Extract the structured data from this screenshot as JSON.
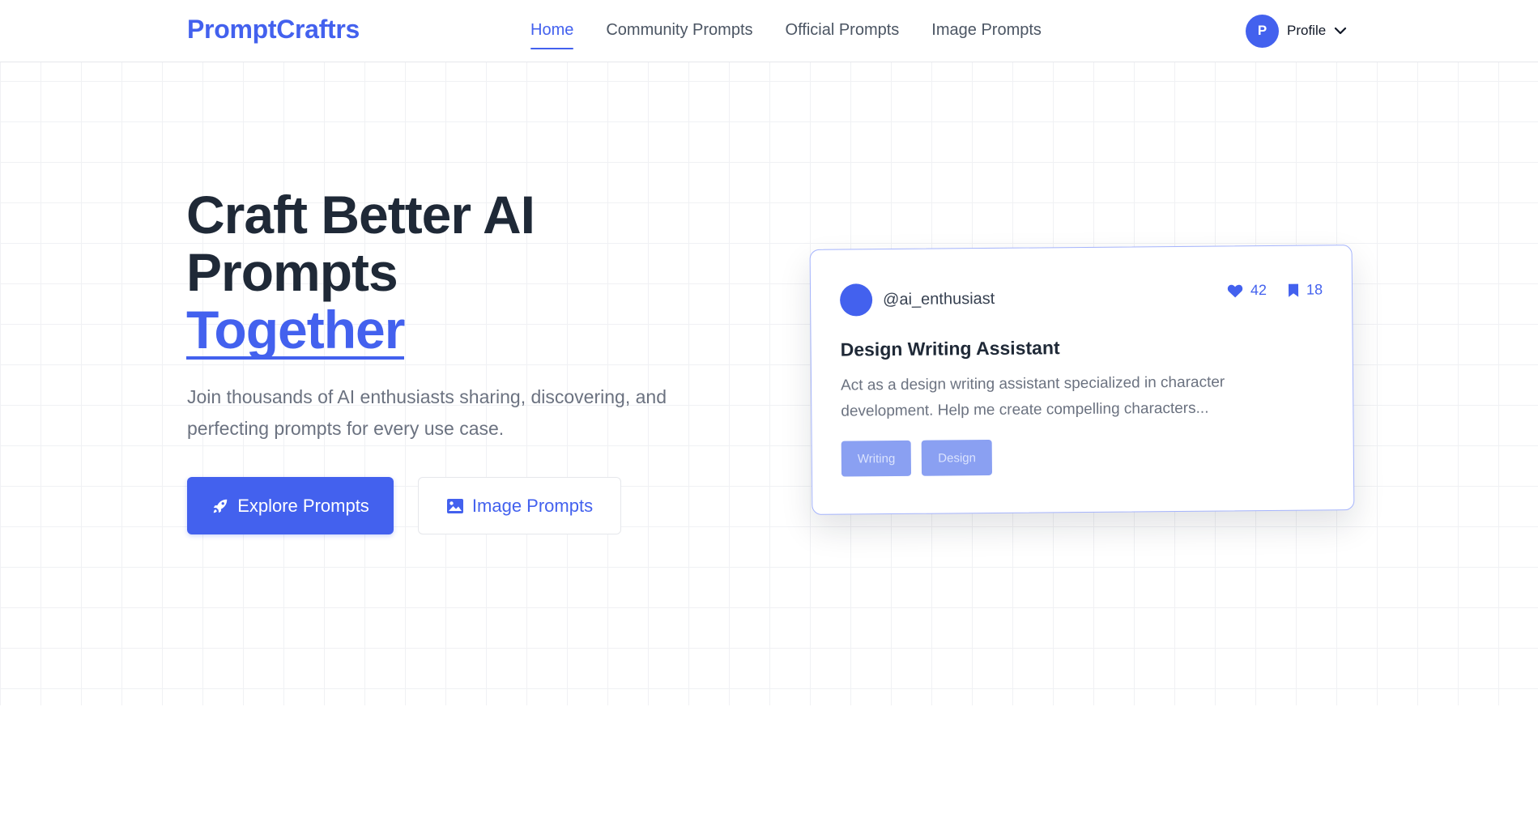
{
  "brand": {
    "name": "PromptCraftrs"
  },
  "nav": {
    "links": [
      {
        "label": "Home",
        "active": true
      },
      {
        "label": "Community Prompts",
        "active": false
      },
      {
        "label": "Official Prompts",
        "active": false
      },
      {
        "label": "Image Prompts",
        "active": false
      }
    ]
  },
  "profile": {
    "initial": "P",
    "label": "Profile",
    "icon": "chevron-down-icon"
  },
  "hero": {
    "title_line1": "Craft Better AI",
    "title_line2": "Prompts",
    "title_accent": "Together",
    "subtitle": "Join thousands of AI enthusiasts sharing, discovering, and perfecting prompts for every use case.",
    "primary_button": {
      "label": "Explore Prompts",
      "icon": "rocket-icon"
    },
    "secondary_button": {
      "label": "Image Prompts",
      "icon": "image-icon"
    }
  },
  "card": {
    "username": "@ai_enthusiast",
    "likes": "42",
    "bookmarks": "18",
    "title": "Design Writing Assistant",
    "description": "Act as a design writing assistant specialized in character development. Help me create compelling characters...",
    "tags": [
      "Writing",
      "Design"
    ]
  },
  "colors": {
    "accent": "#4361ee",
    "text_dark": "#1f2937",
    "text_muted": "#6b7280",
    "tag_bg": "#8aa0f2"
  }
}
